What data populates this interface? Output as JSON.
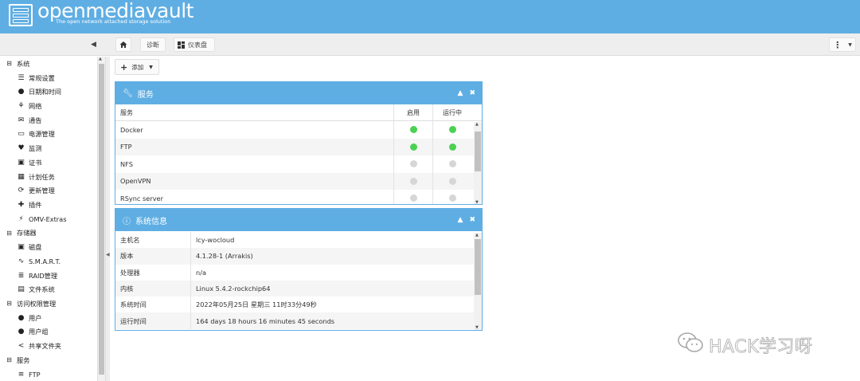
{
  "header": {
    "logo_text": "openmediavault",
    "logo_subtitle": "The open network attached storage solution",
    "brand_color": "#5faee3"
  },
  "toolbar": {
    "collapse_icon": "◀",
    "home_icon": "home-icon",
    "breadcrumb_diag": "诊断",
    "breadcrumb_dashboard": "仪表盘",
    "more_icon": "⋮",
    "more_arrow": "▼"
  },
  "sidebar": {
    "groups": [
      {
        "label": "系统"
      },
      {
        "label": "存储器"
      },
      {
        "label": "访问权限管理"
      },
      {
        "label": "服务"
      }
    ],
    "items": [
      {
        "label": "常规设置",
        "icon": "sliders-icon"
      },
      {
        "label": "日期和时间",
        "icon": "clock-icon"
      },
      {
        "label": "网络",
        "icon": "network-icon"
      },
      {
        "label": "通告",
        "icon": "mail-icon"
      },
      {
        "label": "电源管理",
        "icon": "battery-icon"
      },
      {
        "label": "监测",
        "icon": "heartbeat-icon"
      },
      {
        "label": "证书",
        "icon": "certificate-icon"
      },
      {
        "label": "计划任务",
        "icon": "calendar-icon"
      },
      {
        "label": "更新管理",
        "icon": "refresh-icon"
      },
      {
        "label": "插件",
        "icon": "puzzle-icon"
      },
      {
        "label": "OMV-Extras",
        "icon": "plug-icon"
      },
      {
        "label": "磁盘",
        "icon": "disk-icon"
      },
      {
        "label": "S.M.A.R.T.",
        "icon": "pulse-icon"
      },
      {
        "label": "RAID管理",
        "icon": "database-icon"
      },
      {
        "label": "文件系统",
        "icon": "folder-icon"
      },
      {
        "label": "用户",
        "icon": "user-icon"
      },
      {
        "label": "用户组",
        "icon": "users-icon"
      },
      {
        "label": "共享文件夹",
        "icon": "share-icon"
      },
      {
        "label": "FTP",
        "icon": "server-icon"
      }
    ]
  },
  "main": {
    "add_button": "添加",
    "services_panel": {
      "title": "服务",
      "columns": [
        "服务",
        "启用",
        "运行中"
      ],
      "rows": [
        {
          "name": "Docker",
          "enabled": true,
          "running": true
        },
        {
          "name": "FTP",
          "enabled": true,
          "running": true
        },
        {
          "name": "NFS",
          "enabled": false,
          "running": false
        },
        {
          "name": "OpenVPN",
          "enabled": false,
          "running": false
        },
        {
          "name": "RSync server",
          "enabled": false,
          "running": false
        }
      ],
      "on_color": "#4cd152",
      "off_color": "#d6d6d6"
    },
    "sysinfo_panel": {
      "title": "系统信息",
      "rows": [
        {
          "key": "主机名",
          "value": "lcy-wocloud"
        },
        {
          "key": "版本",
          "value": "4.1.28-1 (Arrakis)"
        },
        {
          "key": "处理器",
          "value": "n/a"
        },
        {
          "key": "内核",
          "value": "Linux 5.4.2-rockchip64"
        },
        {
          "key": "系统时间",
          "value": "2022年05月25日 星期三 11时33分49秒"
        },
        {
          "key": "运行时间",
          "value": "164 days 18 hours 16 minutes 45 seconds"
        }
      ]
    }
  },
  "watermark": {
    "text": "HACK学习呀"
  }
}
